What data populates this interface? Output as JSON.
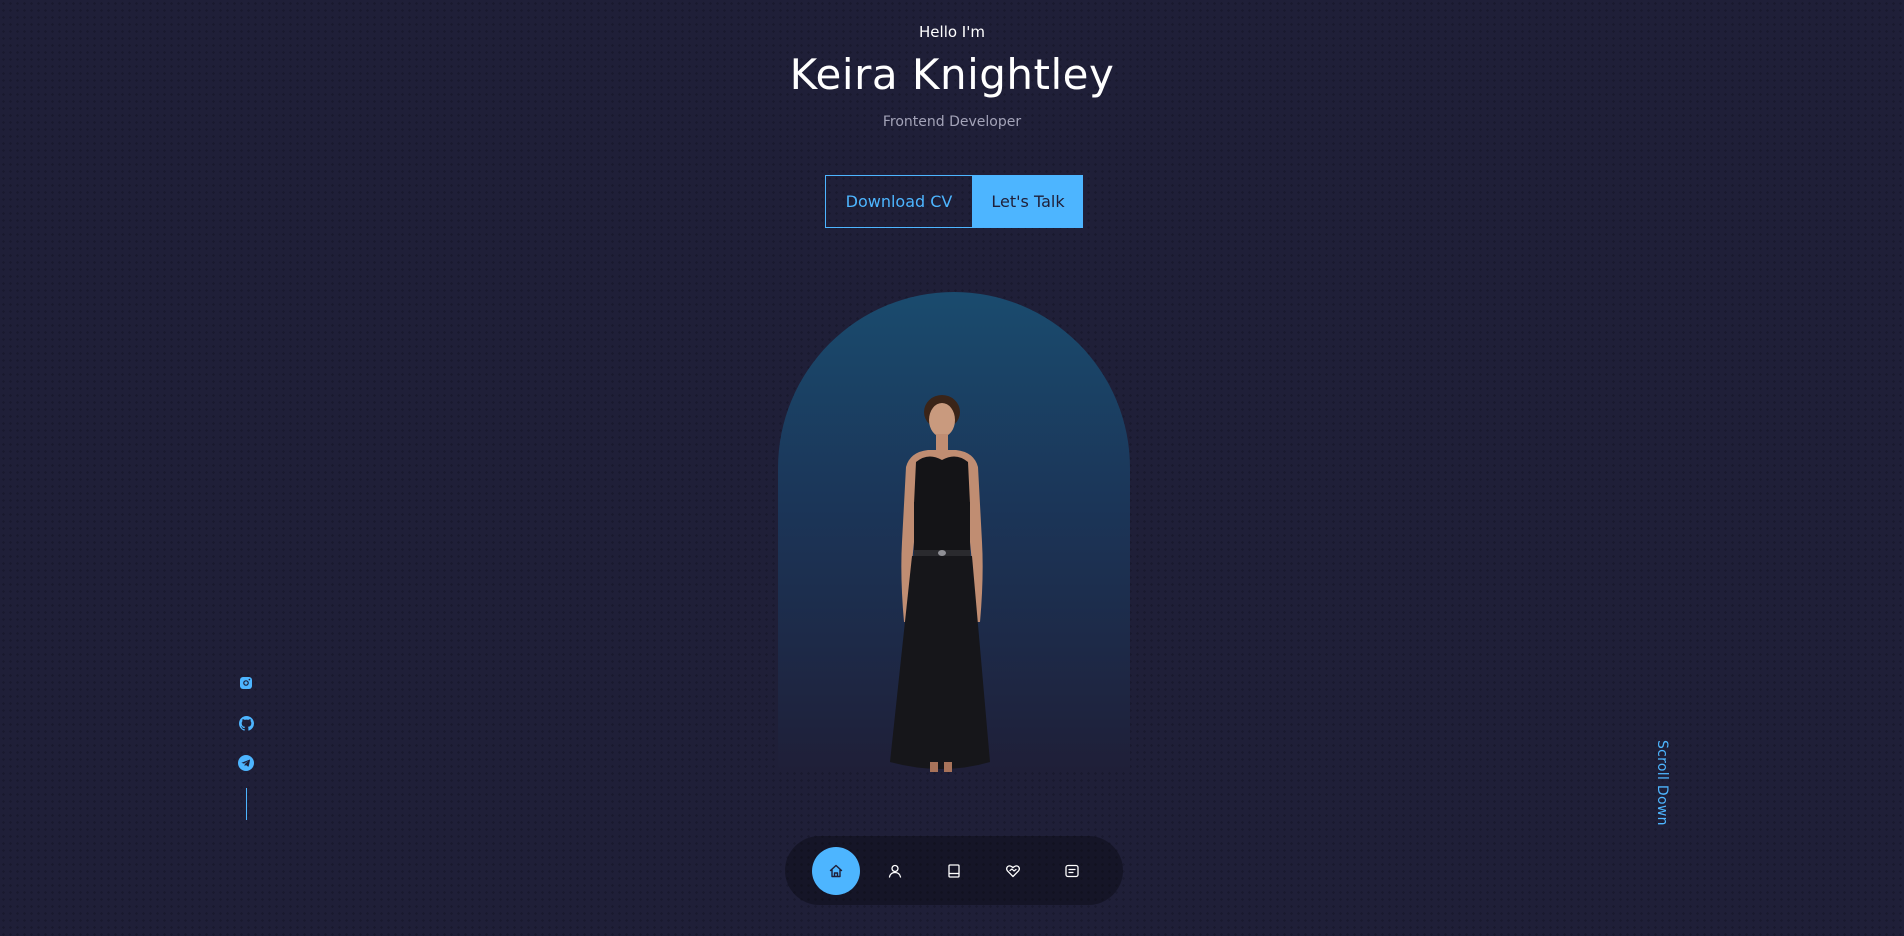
{
  "hero": {
    "greeting": "Hello I'm",
    "name": "Keira Knightley",
    "role": "Frontend Developer"
  },
  "cta": {
    "download_label": "Download CV",
    "talk_label": "Let's Talk"
  },
  "socials": {
    "items": [
      {
        "icon": "instagram-icon"
      },
      {
        "icon": "github-icon"
      },
      {
        "icon": "telegram-icon"
      }
    ]
  },
  "scroll": {
    "label": "Scroll Down"
  },
  "nav": {
    "items": [
      {
        "icon": "home-icon",
        "active": true
      },
      {
        "icon": "user-icon",
        "active": false
      },
      {
        "icon": "book-icon",
        "active": false
      },
      {
        "icon": "services-icon",
        "active": false
      },
      {
        "icon": "message-icon",
        "active": false
      }
    ]
  },
  "colors": {
    "background": "#1f1f38",
    "accent": "#4db5ff",
    "text_light": "#a3a3b8"
  }
}
